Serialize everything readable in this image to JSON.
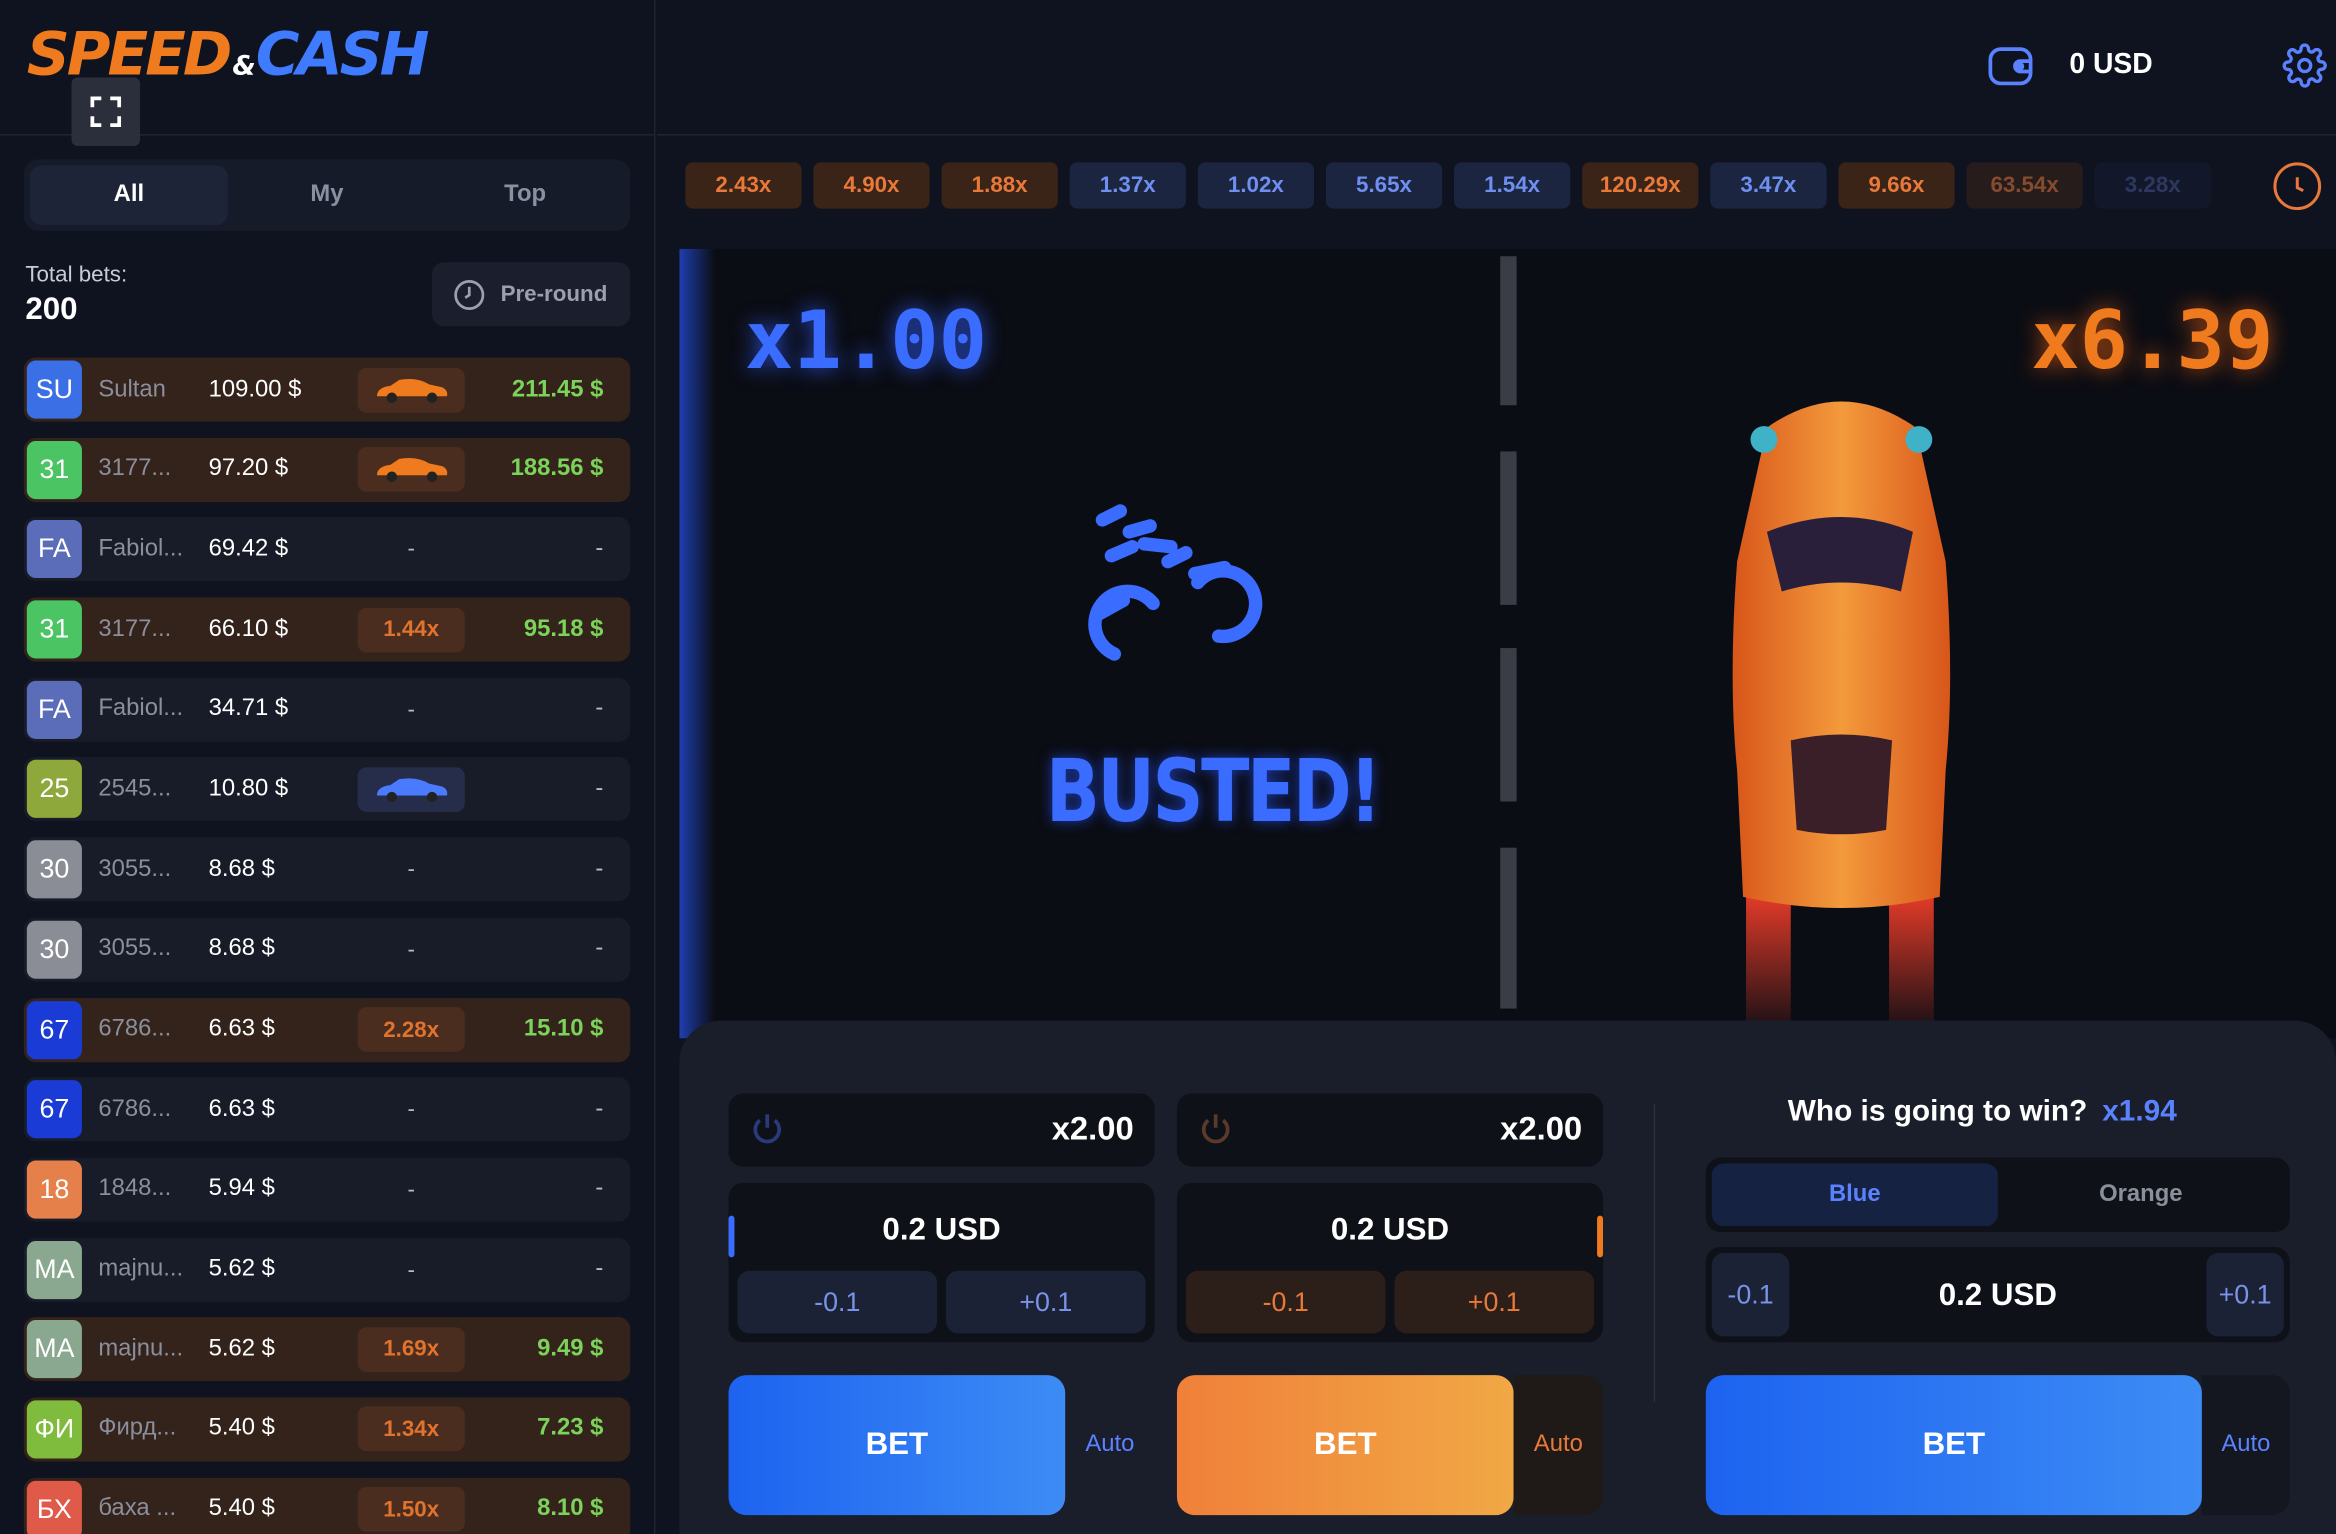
{
  "logo": {
    "speed": "SPEED",
    "amp": "&",
    "cash": "CASH"
  },
  "header": {
    "balance": "0 USD"
  },
  "sidebar": {
    "tabs": [
      "All",
      "My",
      "Top"
    ],
    "total_label": "Total bets:",
    "total_value": "200",
    "preround": "Pre-round",
    "bets": [
      {
        "avatar": "SU",
        "color": "#3b6fe6",
        "name": "Sultan",
        "amount": "109.00 $",
        "mid": "car-orange",
        "win": "211.45 $"
      },
      {
        "avatar": "31",
        "color": "#4bc463",
        "name": "3177...",
        "amount": "97.20 $",
        "mid": "car-orange",
        "win": "188.56 $"
      },
      {
        "avatar": "FA",
        "color": "#5b6cb8",
        "name": "Fabiol...",
        "amount": "69.42 $",
        "mid": "-",
        "win": "-"
      },
      {
        "avatar": "31",
        "color": "#4bc463",
        "name": "3177...",
        "amount": "66.10 $",
        "mid": "1.44x",
        "win": "95.18 $"
      },
      {
        "avatar": "FA",
        "color": "#5b6cb8",
        "name": "Fabiol...",
        "amount": "34.71 $",
        "mid": "-",
        "win": "-"
      },
      {
        "avatar": "25",
        "color": "#8fa83c",
        "name": "2545...",
        "amount": "10.80 $",
        "mid": "car-blue",
        "win": "-"
      },
      {
        "avatar": "30",
        "color": "#8a8d96",
        "name": "3055...",
        "amount": "8.68 $",
        "mid": "-",
        "win": "-"
      },
      {
        "avatar": "30",
        "color": "#8a8d96",
        "name": "3055...",
        "amount": "8.68 $",
        "mid": "-",
        "win": "-"
      },
      {
        "avatar": "67",
        "color": "#1a3bd6",
        "name": "6786...",
        "amount": "6.63 $",
        "mid": "2.28x",
        "win": "15.10 $"
      },
      {
        "avatar": "67",
        "color": "#1a3bd6",
        "name": "6786...",
        "amount": "6.63 $",
        "mid": "-",
        "win": "-"
      },
      {
        "avatar": "18",
        "color": "#e6804a",
        "name": "1848...",
        "amount": "5.94 $",
        "mid": "-",
        "win": "-"
      },
      {
        "avatar": "MA",
        "color": "#8aa88f",
        "name": "majnu...",
        "amount": "5.62 $",
        "mid": "-",
        "win": "-"
      },
      {
        "avatar": "MA",
        "color": "#8aa88f",
        "name": "majnu...",
        "amount": "5.62 $",
        "mid": "1.69x",
        "win": "9.49 $"
      },
      {
        "avatar": "ФИ",
        "color": "#7fbb3d",
        "name": "Фирд...",
        "amount": "5.40 $",
        "mid": "1.34x",
        "win": "7.23 $"
      },
      {
        "avatar": "БХ",
        "color": "#e05a4a",
        "name": "баха ...",
        "amount": "5.40 $",
        "mid": "1.50x",
        "win": "8.10 $"
      }
    ]
  },
  "history": [
    {
      "v": "2.43x",
      "c": "o"
    },
    {
      "v": "4.90x",
      "c": "o"
    },
    {
      "v": "1.88x",
      "c": "o"
    },
    {
      "v": "1.37x",
      "c": "b"
    },
    {
      "v": "1.02x",
      "c": "b"
    },
    {
      "v": "5.65x",
      "c": "b"
    },
    {
      "v": "1.54x",
      "c": "b"
    },
    {
      "v": "120.29x",
      "c": "o"
    },
    {
      "v": "3.47x",
      "c": "b"
    },
    {
      "v": "9.66x",
      "c": "o"
    },
    {
      "v": "63.54x",
      "c": "o"
    },
    {
      "v": "3.28x",
      "c": "b"
    }
  ],
  "game": {
    "mult_blue": "x1.00",
    "mult_orange": "x6.39",
    "status": "BUSTED!"
  },
  "controls": {
    "panel1": {
      "mult": "x2.00",
      "stake": "0.2 USD",
      "minus": "-0.1",
      "plus": "+0.1",
      "bet": "BET",
      "auto": "Auto"
    },
    "panel2": {
      "mult": "x2.00",
      "stake": "0.2 USD",
      "minus": "-0.1",
      "plus": "+0.1",
      "bet": "BET",
      "auto": "Auto"
    },
    "winner": {
      "question": "Who is going to win?",
      "odds": "x1.94",
      "blue": "Blue",
      "orange": "Orange",
      "minus": "-0.1",
      "plus": "+0.1",
      "stake": "0.2 USD",
      "bet": "BET",
      "auto": "Auto"
    }
  },
  "colors": {
    "blue": "#3a6cff",
    "orange": "#f07a1e",
    "win_green": "#7bd35a"
  }
}
